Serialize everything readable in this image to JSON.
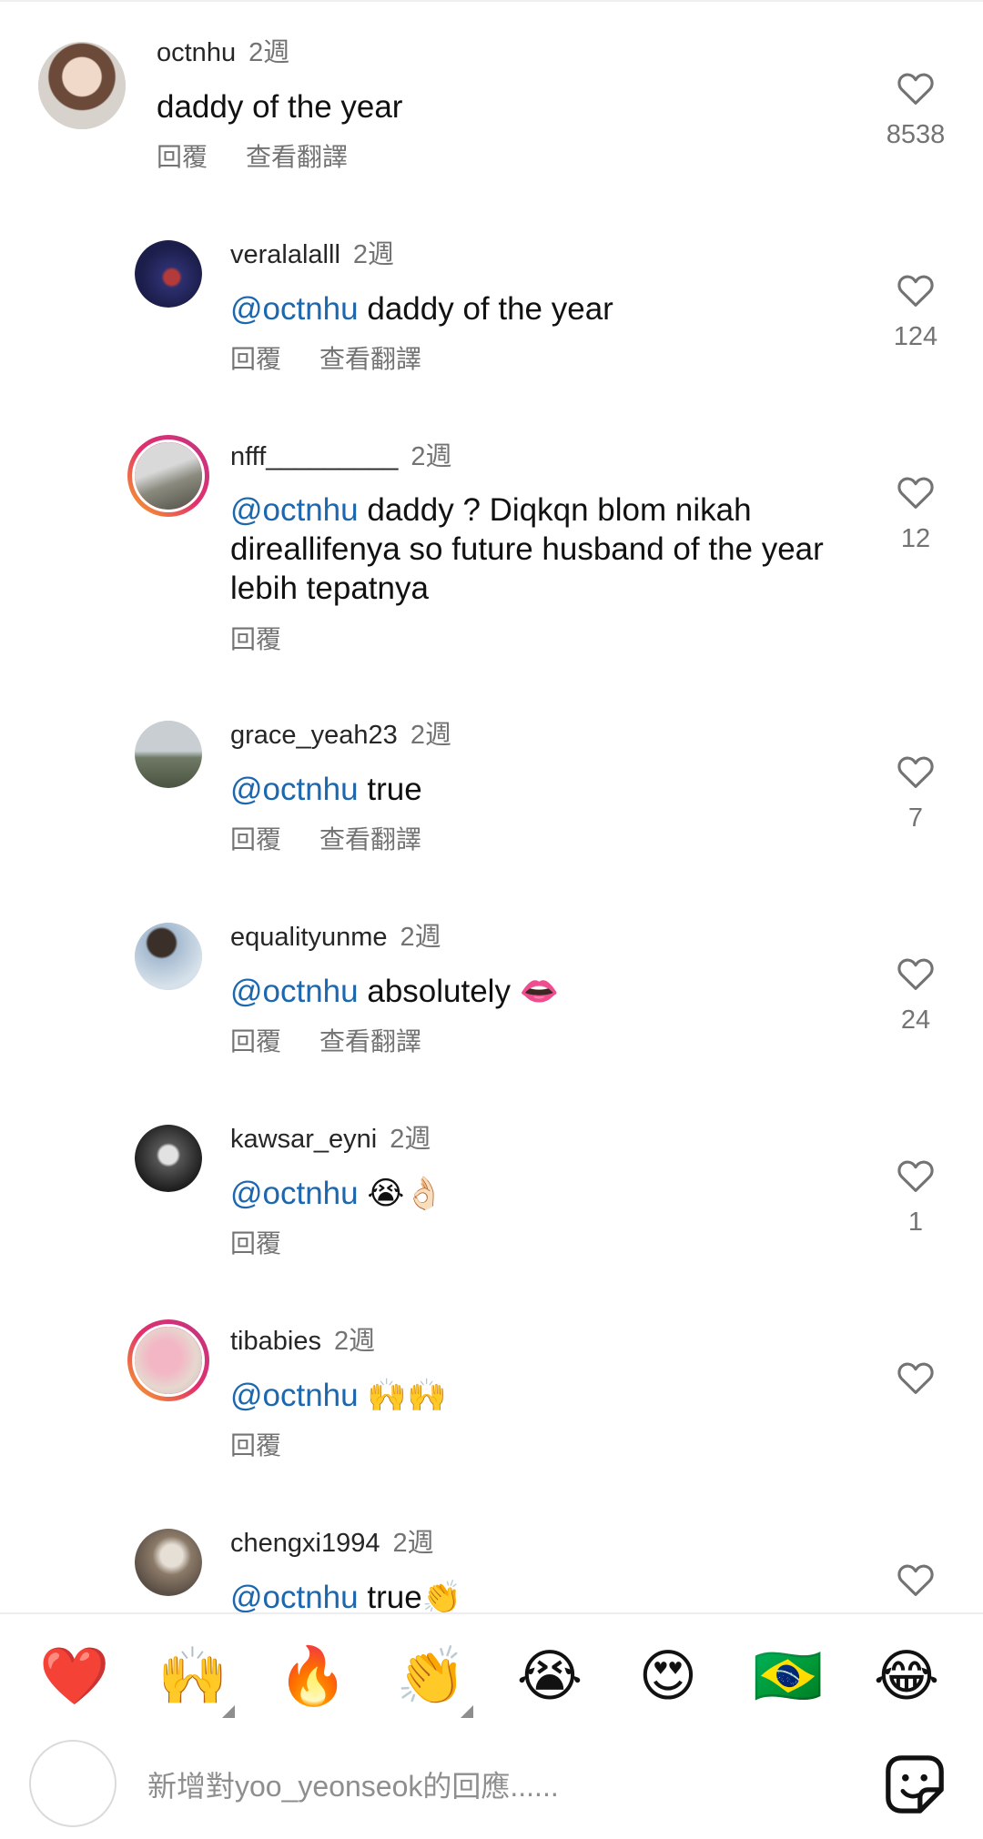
{
  "comments": [
    {
      "username": "octnhu",
      "time": "2週",
      "text": "daddy of the year",
      "mention": "",
      "reply": "回覆",
      "translate": "查看翻譯",
      "likes": "8538"
    },
    {
      "username": "veralalalll",
      "time": "2週",
      "mention": "@octnhu",
      "text": "daddy of the year",
      "reply": "回覆",
      "translate": "查看翻譯",
      "likes": "124"
    },
    {
      "username": "nfff_________",
      "time": "2週",
      "mention": "@octnhu",
      "text": "daddy ? Diqkqn blom nikah direallifenya so future husband of the year lebih tepatnya",
      "reply": "回覆",
      "likes": "12"
    },
    {
      "username": "grace_yeah23",
      "time": "2週",
      "mention": "@octnhu",
      "text": "true",
      "reply": "回覆",
      "translate": "查看翻譯",
      "likes": "7"
    },
    {
      "username": "equalityunme",
      "time": "2週",
      "mention": "@octnhu",
      "text": "absolutely 👄",
      "reply": "回覆",
      "translate": "查看翻譯",
      "likes": "24"
    },
    {
      "username": "kawsar_eyni",
      "time": "2週",
      "mention": "@octnhu",
      "text": "😭👌🏻",
      "reply": "回覆",
      "likes": "1"
    },
    {
      "username": "tibabies",
      "time": "2週",
      "mention": "@octnhu",
      "text": "🙌🙌",
      "reply": "回覆",
      "likes": ""
    },
    {
      "username": "chengxi1994",
      "time": "2週",
      "mention": "@octnhu",
      "text": "true👏",
      "likes": ""
    }
  ],
  "quick_reactions": [
    "❤️",
    "🙌",
    "🔥",
    "👏",
    "😭",
    "😍",
    "🇧🇷",
    "😂"
  ],
  "composer": {
    "placeholder": "新增對yoo_yeonseok的回應......"
  },
  "icons": {
    "like": "heart-outline-icon",
    "sticker": "sticker-icon"
  },
  "colors": {
    "mention": "#1c67ad",
    "secondary_text": "#737373"
  }
}
